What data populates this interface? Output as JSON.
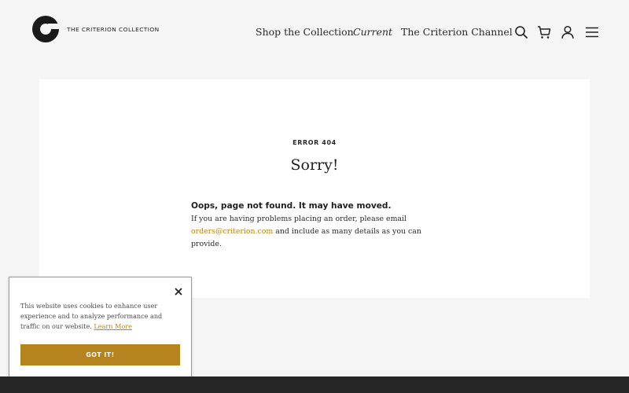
{
  "brand": {
    "name": "THE CRITERION COLLECTION"
  },
  "nav": {
    "items": [
      {
        "label": "Shop the Collection",
        "italic": false
      },
      {
        "label": "Current",
        "italic": true
      },
      {
        "label": "The Criterion Channel",
        "italic": false
      }
    ],
    "icons": [
      "search-icon",
      "cart-icon",
      "account-icon",
      "menu-icon"
    ]
  },
  "error": {
    "eyebrow": "ERROR 404",
    "title": "Sorry!",
    "heading": "Oops, page not found. It may have moved.",
    "body_line1": "If you are having problems placing an order, please email",
    "email_link": "orders@criterion.com",
    "body_line2": " and include as many details as you can provide."
  },
  "cookie_banner": {
    "text": "This website uses cookies to enhance user experience and to analyze performance and traffic on our website.",
    "learn_more": "Learn More",
    "button": "GOT IT!"
  },
  "colors": {
    "accent_gold": "#b5841e",
    "link_gold": "#b8860b",
    "page_bg": "#f5f5f5",
    "footer_bg": "#262626"
  }
}
